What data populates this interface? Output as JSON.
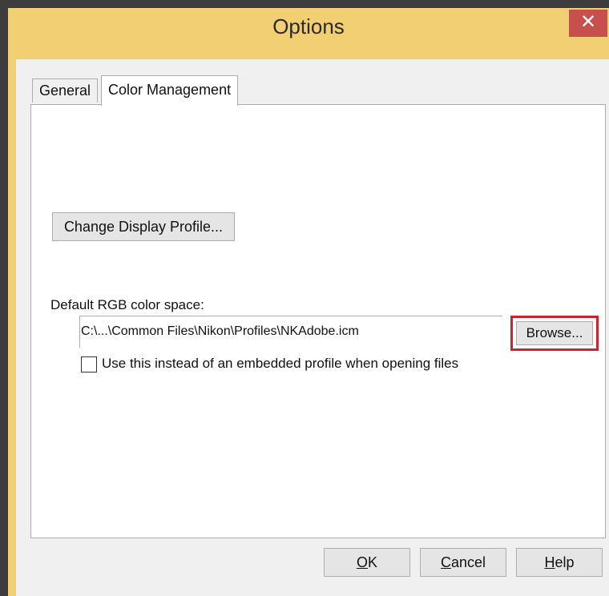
{
  "window": {
    "title": "Options",
    "close_glyph": "✕"
  },
  "tabs": [
    {
      "label": "General",
      "selected": false
    },
    {
      "label": "Color Management",
      "selected": true
    }
  ],
  "panel": {
    "change_display_button": "Change Display Profile...",
    "default_rgb_label": "Default RGB color space:",
    "default_rgb_path": "C:\\...\\Common Files\\Nikon\\Profiles\\NKAdobe.icm",
    "browse_button": "Browse...",
    "use_instead_checkbox": {
      "label": "Use this instead of an embedded profile when opening files",
      "checked": false
    },
    "highlight_color": "#d2202f"
  },
  "footer": {
    "ok_mnemonic": "O",
    "ok_rest": "K",
    "cancel_mnemonic": "C",
    "cancel_rest": "ancel",
    "help_mnemonic": "H",
    "help_rest": "elp"
  },
  "colors": {
    "titlebar": "#f2cf72",
    "close": "#c7504d",
    "background": "#f0f0f0"
  }
}
